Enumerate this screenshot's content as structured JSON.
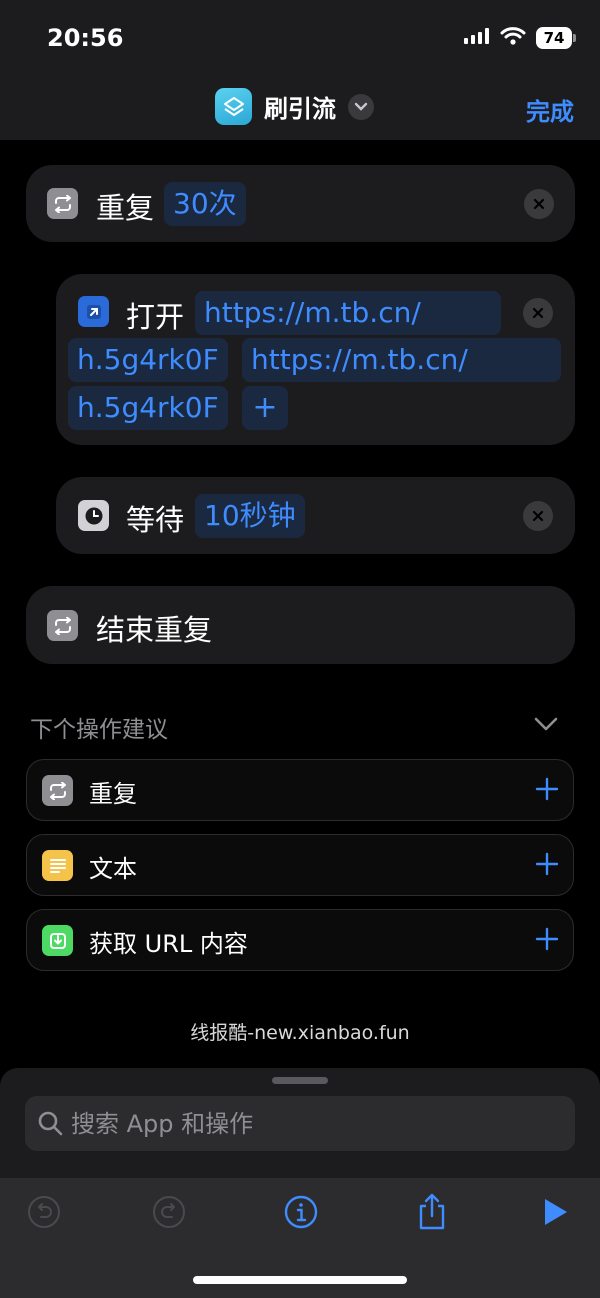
{
  "status_bar": {
    "time": "20:56",
    "battery": "74"
  },
  "nav": {
    "title": "刷引流",
    "done_label": "完成",
    "app_icon": "shortcuts-layers-icon"
  },
  "actions": {
    "repeat": {
      "label": "重复",
      "count_token": "30次"
    },
    "open": {
      "label": "打开",
      "url_line1": "https://m.tb.cn/",
      "url_line2": "h.5g4rk0F",
      "url_line3": "https://m.tb.cn/",
      "url_line4": "h.5g4rk0F",
      "add_symbol": "+"
    },
    "wait": {
      "label": "等待",
      "duration_token": "10秒钟"
    },
    "end_repeat": {
      "label": "结束重复"
    }
  },
  "suggestions": {
    "header": "下个操作建议",
    "items": [
      {
        "label": "重复",
        "icon": "repeat-icon",
        "color": "#8e8e93"
      },
      {
        "label": "文本",
        "icon": "text-icon",
        "color": "#f5c24a"
      },
      {
        "label": "获取 URL 内容",
        "icon": "download-icon",
        "color": "#4cd964"
      }
    ]
  },
  "watermark": "线报酷-new.xianbao.fun",
  "search": {
    "placeholder": "搜索 App 和操作"
  },
  "colors": {
    "accent": "#3f8cff",
    "card": "#1c1c1e",
    "token_bg": "#1a2840"
  }
}
